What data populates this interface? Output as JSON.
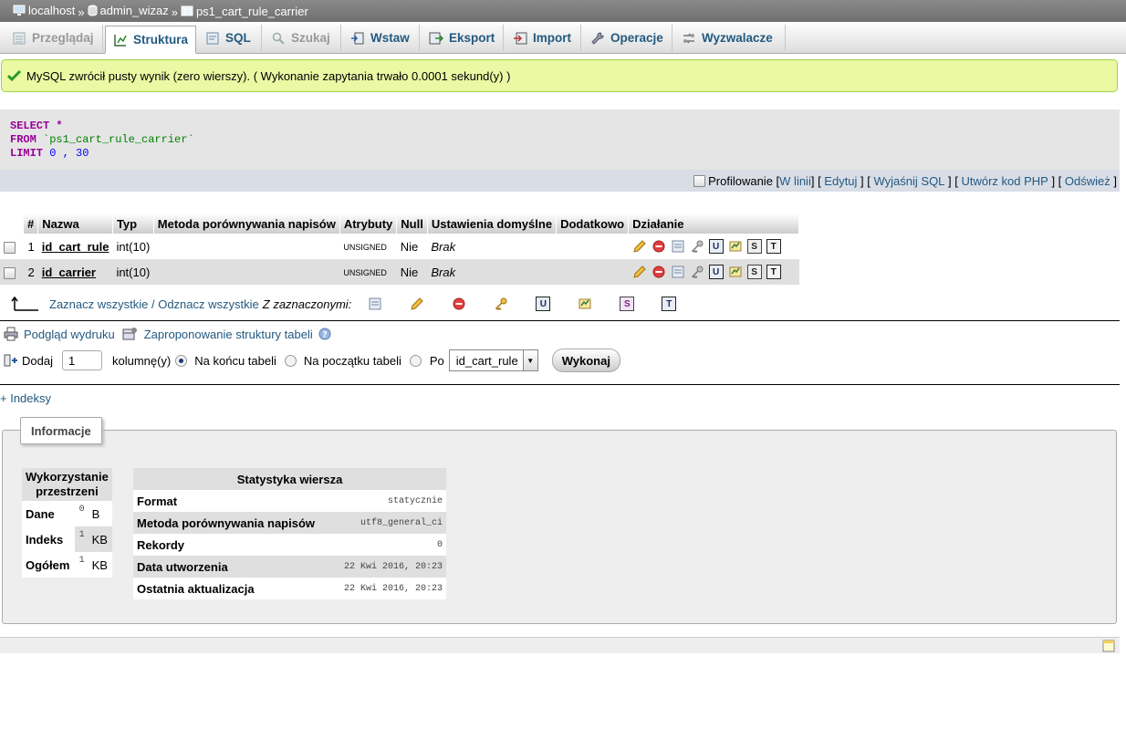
{
  "breadcrumb": {
    "server": "localhost",
    "database": "admin_wizaz",
    "table": "ps1_cart_rule_carrier",
    "separator": "»"
  },
  "tabs": [
    {
      "label": "Przeglądaj",
      "icon": "browse-icon",
      "state": "inactive"
    },
    {
      "label": "Struktura",
      "icon": "structure-icon",
      "state": "active"
    },
    {
      "label": "SQL",
      "icon": "sql-icon",
      "state": "normal"
    },
    {
      "label": "Szukaj",
      "icon": "search-icon",
      "state": "inactive"
    },
    {
      "label": "Wstaw",
      "icon": "insert-icon",
      "state": "normal"
    },
    {
      "label": "Eksport",
      "icon": "export-icon",
      "state": "normal"
    },
    {
      "label": "Import",
      "icon": "import-icon",
      "state": "normal"
    },
    {
      "label": "Operacje",
      "icon": "wrench-icon",
      "state": "normal"
    },
    {
      "label": "Wyzwalacze",
      "icon": "triggers-icon",
      "state": "normal"
    }
  ],
  "message": {
    "text": "MySQL zwrócił pusty wynik (zero wierszy). ( Wykonanie zapytania trwało 0.0001 sekund(y) )"
  },
  "sql": {
    "line1_kw": "SELECT",
    "line1_rest": " *",
    "line2_kw": "FROM",
    "line2_rest": " `ps1_cart_rule_carrier`",
    "line3_kw": "LIMIT",
    "line3_rest": " 0 , 30"
  },
  "query_links": {
    "profiling": "Profilowanie",
    "inline": "W linii",
    "edit": "Edytuj",
    "explain": "Wyjaśnij SQL",
    "php": "Utwórz kod PHP",
    "refresh": "Odśwież"
  },
  "structure": {
    "headers": [
      "#",
      "Nazwa",
      "Typ",
      "Metoda porównywania napisów",
      "Atrybuty",
      "Null",
      "Ustawienia domyślne",
      "Dodatkowo",
      "Działanie"
    ],
    "rows": [
      {
        "num": "1",
        "name": "id_cart_rule",
        "type": "int(10)",
        "collation": "",
        "attributes": "UNSIGNED",
        "null": "Nie",
        "default": "Brak",
        "extra": ""
      },
      {
        "num": "2",
        "name": "id_carrier",
        "type": "int(10)",
        "collation": "",
        "attributes": "UNSIGNED",
        "null": "Nie",
        "default": "Brak",
        "extra": ""
      }
    ]
  },
  "check_all": {
    "check_all": "Zaznacz wszystkie",
    "divider": " / ",
    "uncheck_all": "Odznacz wszystkie",
    "with_selected": "Z zaznaczonymi:"
  },
  "print_row": {
    "print_view": "Podgląd wydruku",
    "propose": "Zaproponowanie struktury tabeli"
  },
  "add_column": {
    "add": "Dodaj",
    "count": "1",
    "columns": "kolumnę(y)",
    "at_end": "Na końcu tabeli",
    "at_start": "Na początku tabeli",
    "after": "Po",
    "after_field": "id_cart_rule",
    "go": "Wykonaj"
  },
  "indexes": {
    "label": "+ Indeksy"
  },
  "info": {
    "legend": "Informacje",
    "space": {
      "header": "Wykorzystanie przestrzeni",
      "rows": [
        {
          "label": "Dane",
          "value": "0",
          "unit": "B"
        },
        {
          "label": "Indeks",
          "value": "1",
          "unit": "KB"
        },
        {
          "label": "Ogółem",
          "value": "1",
          "unit": "KB"
        }
      ]
    },
    "stats": {
      "header": "Statystyka wiersza",
      "rows": [
        {
          "label": "Format",
          "value": "statycznie"
        },
        {
          "label": "Metoda porównywania napisów",
          "value": "utf8_general_ci"
        },
        {
          "label": "Rekordy",
          "value": "0"
        },
        {
          "label": "Data utworzenia",
          "value": "22 Kwi 2016, 20:23"
        },
        {
          "label": "Ostatnia aktualizacja",
          "value": "22 Kwi 2016, 20:23"
        }
      ]
    }
  }
}
